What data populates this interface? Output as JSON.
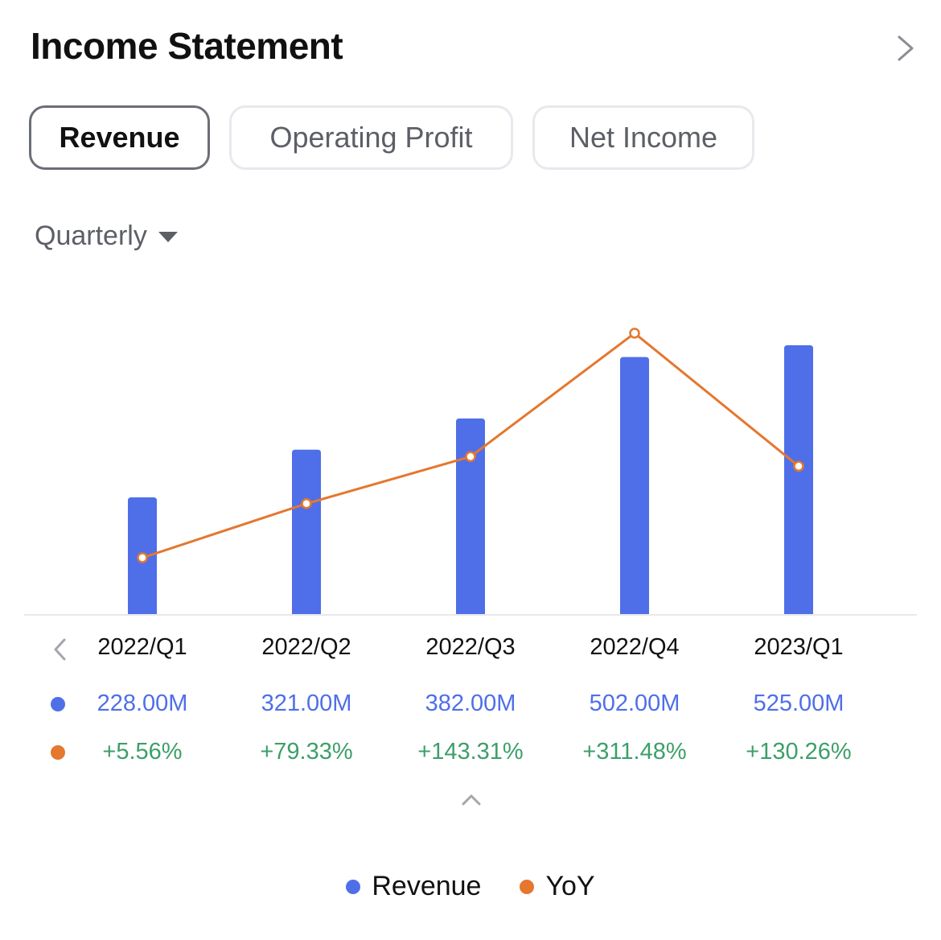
{
  "header": {
    "title": "Income Statement",
    "more_icon": "chevron-right-icon"
  },
  "tabs": [
    {
      "label": "Revenue",
      "active": true
    },
    {
      "label": "Operating Profit",
      "active": false
    },
    {
      "label": "Net Income",
      "active": false
    }
  ],
  "period_select": {
    "value": "Quarterly",
    "icon": "caret-down-icon"
  },
  "colors": {
    "revenue": "#4f6fe8",
    "yoy": "#e5772f",
    "positive": "#3d9f6a",
    "axis": "#e8e8ea"
  },
  "chart_data": {
    "type": "bar",
    "title": "",
    "xlabel": "",
    "ylabel": "",
    "categories": [
      "2022/Q1",
      "2022/Q2",
      "2022/Q3",
      "2022/Q4",
      "2023/Q1"
    ],
    "series": [
      {
        "name": "Revenue",
        "type": "bar",
        "unit": "M",
        "values": [
          228.0,
          321.0,
          382.0,
          502.0,
          525.0
        ],
        "labels": [
          "228.00M",
          "321.00M",
          "382.00M",
          "502.00M",
          "525.00M"
        ]
      },
      {
        "name": "YoY",
        "type": "line",
        "unit": "%",
        "values": [
          5.56,
          79.33,
          143.31,
          311.48,
          130.26
        ],
        "labels": [
          "+5.56%",
          "+79.33%",
          "+143.31%",
          "+311.48%",
          "+130.26%"
        ]
      }
    ],
    "grid": false,
    "legend": "bottom-center"
  },
  "navigation": {
    "prev_icon": "chevron-left-icon",
    "collapse_icon": "chevron-up-icon"
  },
  "legend": [
    {
      "label": "Revenue"
    },
    {
      "label": "YoY"
    }
  ]
}
